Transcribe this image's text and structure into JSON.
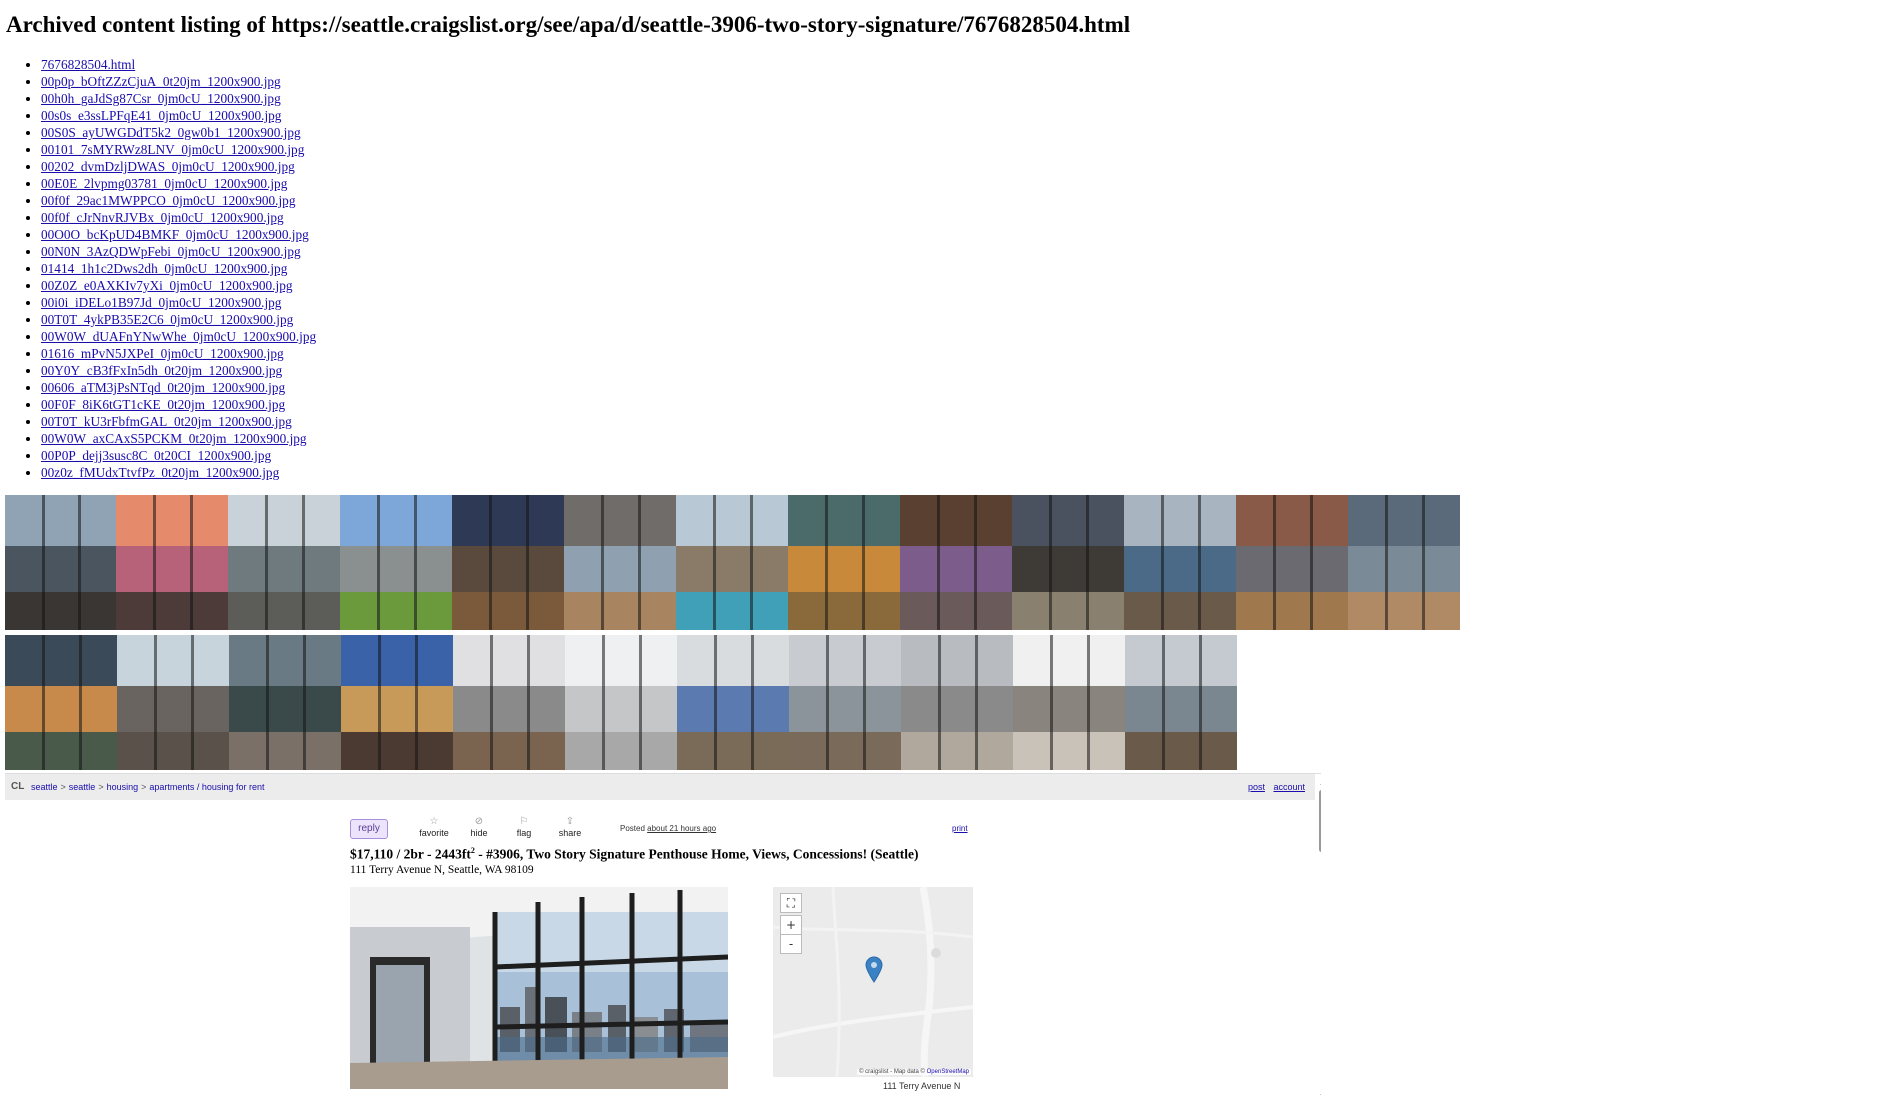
{
  "page": {
    "heading": "Archived content listing of https://seattle.craigslist.org/see/apa/d/seattle-3906-two-story-signature/7676828504.html"
  },
  "files": [
    "7676828504.html",
    "00p0p_bOftZZzCjuA_0t20jm_1200x900.jpg",
    "00h0h_gaJdSg87Csr_0jm0cU_1200x900.jpg",
    "00s0s_e3ssLPFqE41_0jm0cU_1200x900.jpg",
    "00S0S_ayUWGDdT5k2_0gw0b1_1200x900.jpg",
    "00101_7sMYRWz8LNV_0jm0cU_1200x900.jpg",
    "00202_dvmDzljDWAS_0jm0cU_1200x900.jpg",
    "00E0E_2lvpmg03781_0jm0cU_1200x900.jpg",
    "00f0f_29ac1MWPPCO_0jm0cU_1200x900.jpg",
    "00f0f_cJrNnvRJVBx_0jm0cU_1200x900.jpg",
    "00O0O_bcKpUD4BMKF_0jm0cU_1200x900.jpg",
    "00N0N_3AzQDWpFebi_0jm0cU_1200x900.jpg",
    "01414_1h1c2Dws2dh_0jm0cU_1200x900.jpg",
    "00Z0Z_e0AXKIv7yXi_0jm0cU_1200x900.jpg",
    "00i0i_iDELo1B97Jd_0jm0cU_1200x900.jpg",
    "00T0T_4ykPB35E2C6_0jm0cU_1200x900.jpg",
    "00W0W_dUAFnYNwWhe_0jm0cU_1200x900.jpg",
    "01616_mPvN5JXPeI_0jm0cU_1200x900.jpg",
    "00Y0Y_cB3fFxIn5dh_0t20jm_1200x900.jpg",
    "00606_aTM3jPsNTqd_0t20jm_1200x900.jpg",
    "00F0F_8iK6tGT1cKE_0t20jm_1200x900.jpg",
    "00T0T_kU3rFbfmGAL_0t20jm_1200x900.jpg",
    "00W0W_axCAxS5PCKM_0t20jm_1200x900.jpg",
    "00P0P_dejj3susc8C_0t20CI_1200x900.jpg",
    "00z0z_fMUdxTtvfPz_0t20jm_1200x900.jpg"
  ],
  "thumbs_row1": [
    {
      "name": "thumb-window-view-room",
      "c1": "#8fa3b5",
      "c2": "#4a5560",
      "c3": "#3a3634"
    },
    {
      "name": "thumb-rooftop-sunset-lounge",
      "c1": "#e58a6a",
      "c2": "#b8627a",
      "c3": "#4d3b3a"
    },
    {
      "name": "thumb-dining-table-terrace",
      "c1": "#c9d2d8",
      "c2": "#6f7a7e",
      "c3": "#5c5c58"
    },
    {
      "name": "thumb-rooftop-lawn-city",
      "c1": "#7da7d8",
      "c2": "#8a8f8f",
      "c3": "#6b9a3c"
    },
    {
      "name": "thumb-city-night-aerial",
      "c1": "#2e3a55",
      "c2": "#5a4a3e",
      "c3": "#7a5a3a"
    },
    {
      "name": "thumb-gym-room",
      "c1": "#6f6c6a",
      "c2": "#8fa0b0",
      "c3": "#a88460"
    },
    {
      "name": "thumb-outdoor-patio-seating",
      "c1": "#b8c8d4",
      "c2": "#8a7a68",
      "c3": "#40a0b8"
    },
    {
      "name": "thumb-lounge-orange-chairs",
      "c1": "#4b6a6a",
      "c2": "#c88a3a",
      "c3": "#8a6a3a"
    },
    {
      "name": "thumb-media-lounge-tv",
      "c1": "#5a4030",
      "c2": "#7c5c8a",
      "c3": "#6a5a5a"
    },
    {
      "name": "thumb-club-room-kitchen",
      "c1": "#4a5260",
      "c2": "#3e3a36",
      "c3": "#8a8070"
    },
    {
      "name": "thumb-window-lounge-blue-chairs",
      "c1": "#a8b4c0",
      "c2": "#4a6a88",
      "c3": "#6a5a4a"
    },
    {
      "name": "thumb-brick-lounge",
      "c1": "#8a5a48",
      "c2": "#6a6a70",
      "c3": "#a0784e"
    },
    {
      "name": "thumb-fitness-center",
      "c1": "#5a6a7a",
      "c2": "#7a8a96",
      "c3": "#b08a64"
    }
  ],
  "thumbs_row2": [
    {
      "name": "thumb-library-game-room",
      "c1": "#3a4a58",
      "c2": "#c88a4a",
      "c3": "#4a5a4a"
    },
    {
      "name": "thumb-rooftop-deck-furniture",
      "c1": "#c8d4dc",
      "c2": "#6a6460",
      "c3": "#5a524a"
    },
    {
      "name": "thumb-glass-walkway",
      "c1": "#6a7a84",
      "c2": "#3a4a4a",
      "c3": "#7a7068"
    },
    {
      "name": "thumb-rooftop-dusk-lounge",
      "c1": "#3a62a8",
      "c2": "#c89a5a",
      "c3": "#4a3a32"
    },
    {
      "name": "thumb-penthouse-living-room",
      "c1": "#e0e0e2",
      "c2": "#8a8a8a",
      "c3": "#7a6450"
    },
    {
      "name": "thumb-white-kitchen",
      "c1": "#eef0f2",
      "c2": "#c4c6c8",
      "c3": "#a8a8a8"
    },
    {
      "name": "thumb-stairway-blue",
      "c1": "#d8dcdf",
      "c2": "#5a7ab0",
      "c3": "#7a6a58"
    },
    {
      "name": "thumb-refrigerator-kitchen",
      "c1": "#c8ccd0",
      "c2": "#8a949a",
      "c3": "#7a6a5a"
    },
    {
      "name": "thumb-bathroom-glass",
      "c1": "#b8bcc0",
      "c2": "#8a8a8a",
      "c3": "#b0a89c"
    },
    {
      "name": "thumb-closet-doorway",
      "c1": "#f0f0f0",
      "c2": "#8a847e",
      "c3": "#c8c2b8"
    },
    {
      "name": "thumb-city-view-windows",
      "c1": "#c4cad0",
      "c2": "#7a8690",
      "c3": "#6a5a4a"
    }
  ],
  "crumbs": {
    "logo": "CL",
    "items": [
      "seattle",
      "seattle",
      "housing",
      "apartments / housing for rent"
    ],
    "separator": ">",
    "post": "post",
    "account": "account"
  },
  "actions": {
    "reply": "reply",
    "favorite": "favorite",
    "hide": "hide",
    "flag": "flag",
    "share": "share",
    "posted_label": "Posted",
    "posted_time": "about 21 hours ago",
    "print": "print"
  },
  "posting": {
    "title_before_sup": "$17,110 / 2br - 2443ft",
    "title_sup": "2",
    "title_after_sup": " - #3906, Two Story Signature Penthouse Home, Views, Concessions! (Seattle)",
    "address": "111 Terry Avenue N, Seattle, WA 98109"
  },
  "map": {
    "fullscreen": "⛶",
    "zoom_in": "+",
    "zoom_out": "-",
    "attribution": "© craigslist - Map data ©",
    "attribution_link": "OpenStreetMap",
    "street_label": "111 Terry Avenue N"
  },
  "colors": {
    "link": "#1a0dab",
    "reply_bg": "#ece4fb",
    "map_pin": "#3b82c4"
  }
}
